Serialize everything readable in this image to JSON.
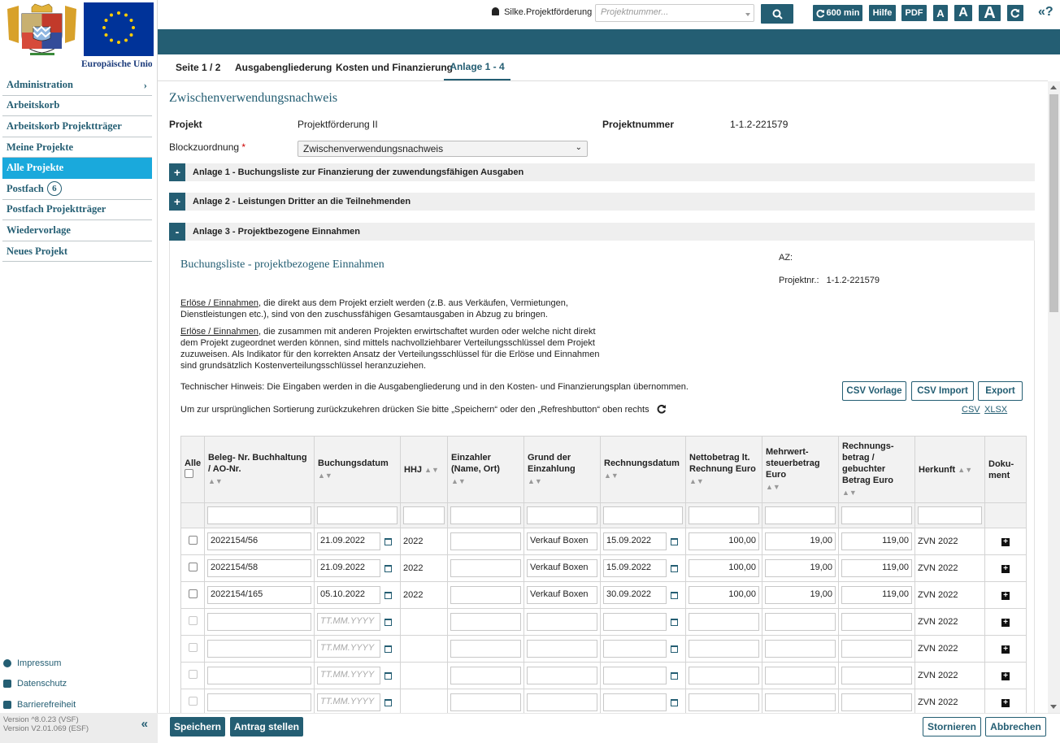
{
  "sidebar": {
    "eu_caption": "Europäische Union",
    "nav": [
      {
        "label": "Administration",
        "chevron": "›"
      },
      {
        "label": "Arbeitskorb"
      },
      {
        "label": "Arbeitskorb Projektträger"
      },
      {
        "label": "Meine Projekte"
      },
      {
        "label": "Alle Projekte",
        "active": true
      },
      {
        "label": "Postfach",
        "badge": "6"
      },
      {
        "label": "Postfach Projektträger"
      },
      {
        "label": "Wiedervorlage"
      },
      {
        "label": "Neues Projekt"
      }
    ],
    "footer_links": [
      {
        "label": "Impressum",
        "icon": "help-circle-icon"
      },
      {
        "label": "Datenschutz",
        "icon": "user-card-icon"
      },
      {
        "label": "Barrierefreiheit",
        "icon": "external-edit-icon"
      }
    ],
    "version_line1": "Version ^8.0.23 (VSF)",
    "version_line2": "Version V2.01.069 (ESF)",
    "collapse_label": "«"
  },
  "topbar": {
    "user": "Silke.Projektförderung",
    "project_search_placeholder": "Projektnummer...",
    "session_label": "600 min",
    "help_label": "Hilfe",
    "pdf_label": "PDF",
    "font_small": "A",
    "font_medium": "A",
    "font_large": "A",
    "expand_label": "«?",
    "accent": "#245e73",
    "active_nav": "#1aa9dc"
  },
  "tabs": [
    {
      "label": "Seite 1 / 2"
    },
    {
      "label": "Ausgabengliederung"
    },
    {
      "label": "Kosten und Finanzierung"
    },
    {
      "label": "Anlage 1 - 4",
      "active": true
    }
  ],
  "main": {
    "title": "Zwischenverwendungsnachweis",
    "projekt_label": "Projekt",
    "projekt_value": "Projektförderung II",
    "projektnummer_label": "Projektnummer",
    "projektnummer_value": "1-1.2-221579",
    "block_label": "Blockzuordnung",
    "block_required": "*",
    "block_value": "Zwischenverwendungsnachweis",
    "accordions": [
      {
        "sign": "+",
        "label": "Anlage 1 - Buchungsliste zur Finanzierung der zuwendungsfähigen Ausgaben"
      },
      {
        "sign": "+",
        "label": "Anlage 2 - Leistungen Dritter an die Teilnehmenden"
      },
      {
        "sign": "-",
        "label": "Anlage 3 - Projektbezogene Einnahmen"
      }
    ]
  },
  "panel": {
    "title": "Buchungsliste - projektbezogene Einnahmen",
    "az_label": "AZ:",
    "projektnr_label": "Projektnr.:",
    "projektnr_value": "1-1.2-221579",
    "p1_link": "Erlöse / Einnahmen",
    "p1_line1_rest": ", die direkt aus dem Projekt erzielt werden (z.B. aus Verkäufen, Vermietungen,",
    "p1_line2": "Dienstleistungen etc.), sind von den zuschussfähigen Gesamtausgaben in Abzug zu bringen.",
    "p2_link": "Erlöse / Einnahmen",
    "p2_line1_rest": ", die zusammen mit anderen Projekten erwirtschaftet wurden oder welche nicht direkt",
    "p2_line2": "dem Projekt zugeordnet werden können, sind mittels nachvollziehbarer Verteilungsschlüssel dem Projekt",
    "p2_line3": "zuzuweisen. Als Indikator für den korrekten Ansatz der Verteilungsschlüssel für die Erlöse und Einnahmen",
    "p2_line4": "sind grundsätzlich Kostenverteilungsschlüssel heranzuziehen.",
    "tech_hint": "Technischer Hinweis: Die Eingaben werden in die Ausgabengliederung und in den Kosten- und Finanzierungsplan übernommen.",
    "sort_hint": "Um zur ursprünglichen Sortierung zurückzukehren drücken Sie bitte „Speichern“ oder den „Refreshbutton“ oben rechts",
    "btn_csv_vorlage": "CSV Vorlage",
    "btn_csv_import": "CSV Import",
    "btn_export": "Export",
    "link_csv": "CSV",
    "link_xlsx": "XLSX"
  },
  "table": {
    "headers": {
      "alle": "Alle",
      "beleg": "Beleg- Nr. Buchhaltung / AO-Nr.",
      "buchungsdatum": "Buchungsdatum",
      "hhj": "HHJ",
      "einzahler": "Einzahler (Name, Ort)",
      "grund": "Grund der Einzahlung",
      "rechnungsdatum": "Rechnungsdatum",
      "netto": "Nettobetrag lt. Rechnung Euro",
      "mwst": "Mehrwert-steuerbetrag Euro",
      "brutto": "Rechnungs-betrag / gebuchter Betrag Euro",
      "herkunft": "Herkunft",
      "dokument": "Doku-ment"
    },
    "date_placeholder": "TT.MM.YYYY",
    "rows": [
      {
        "beleg": "2022154/56",
        "buchungsdatum": "21.09.2022",
        "hhj": "2022",
        "einzahler": "",
        "grund": "Verkauf Boxen",
        "rechnungsdatum": "15.09.2022",
        "netto": "100,00",
        "mwst": "19,00",
        "brutto": "119,00",
        "herkunft": "ZVN 2022"
      },
      {
        "beleg": "2022154/58",
        "buchungsdatum": "21.09.2022",
        "hhj": "2022",
        "einzahler": "",
        "grund": "Verkauf Boxen",
        "rechnungsdatum": "15.09.2022",
        "netto": "100,00",
        "mwst": "19,00",
        "brutto": "119,00",
        "herkunft": "ZVN 2022"
      },
      {
        "beleg": "2022154/165",
        "buchungsdatum": "05.10.2022",
        "hhj": "2022",
        "einzahler": "",
        "grund": "Verkauf Boxen",
        "rechnungsdatum": "30.09.2022",
        "netto": "100,00",
        "mwst": "19,00",
        "brutto": "119,00",
        "herkunft": "ZVN 2022"
      },
      {
        "beleg": "",
        "buchungsdatum": "",
        "hhj": "",
        "einzahler": "",
        "grund": "",
        "rechnungsdatum": "",
        "netto": "",
        "mwst": "",
        "brutto": "",
        "herkunft": "ZVN 2022"
      },
      {
        "beleg": "",
        "buchungsdatum": "",
        "hhj": "",
        "einzahler": "",
        "grund": "",
        "rechnungsdatum": "",
        "netto": "",
        "mwst": "",
        "brutto": "",
        "herkunft": "ZVN 2022"
      },
      {
        "beleg": "",
        "buchungsdatum": "",
        "hhj": "",
        "einzahler": "",
        "grund": "",
        "rechnungsdatum": "",
        "netto": "",
        "mwst": "",
        "brutto": "",
        "herkunft": "ZVN 2022"
      },
      {
        "beleg": "",
        "buchungsdatum": "",
        "hhj": "",
        "einzahler": "",
        "grund": "",
        "rechnungsdatum": "",
        "netto": "",
        "mwst": "",
        "brutto": "",
        "herkunft": "ZVN 2022"
      }
    ]
  },
  "bottombar": {
    "save": "Speichern",
    "submit": "Antrag stellen",
    "cancel": "Stornieren",
    "abort": "Abbrechen"
  }
}
